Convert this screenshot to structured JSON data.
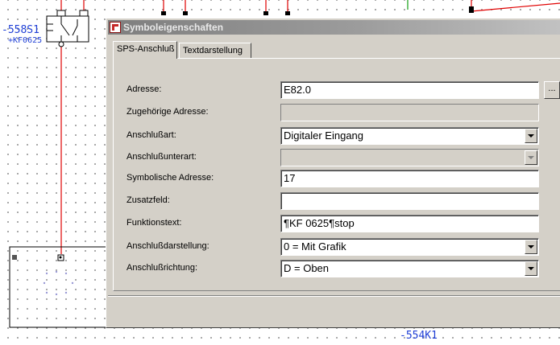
{
  "canvas": {
    "device_left": "-558S1",
    "device_left_sub": "+KF0625",
    "device_bottom": "-554K1"
  },
  "dialog": {
    "title": "Symboleigenschaften",
    "tabs": [
      {
        "label": "SPS-Anschluß",
        "active": true
      },
      {
        "label": "Textdarstellung",
        "active": false
      }
    ],
    "fields": {
      "adresse": {
        "label": "Adresse:",
        "value": "E82.0",
        "browse": "..."
      },
      "zugehoerige_adresse": {
        "label": "Zugehörige Adresse:",
        "value": ""
      },
      "anschlussart": {
        "label": "Anschlußart:",
        "value": "Digitaler Eingang"
      },
      "anschlussunterart": {
        "label": "Anschlußunterart:",
        "value": ""
      },
      "symbolische_adresse": {
        "label": "Symbolische Adresse:",
        "value": "17"
      },
      "zusatzfeld": {
        "label": "Zusatzfeld:",
        "value": ""
      },
      "funktionstext": {
        "label": "Funktionstext:",
        "value": "¶KF 0625¶stop"
      },
      "anschlussdarstellung": {
        "label": "Anschlußdarstellung:",
        "value": "0 = Mit Grafik"
      },
      "anschlussrichtung": {
        "label": "Anschlußrichtung:",
        "value": "D = Oben"
      }
    }
  }
}
